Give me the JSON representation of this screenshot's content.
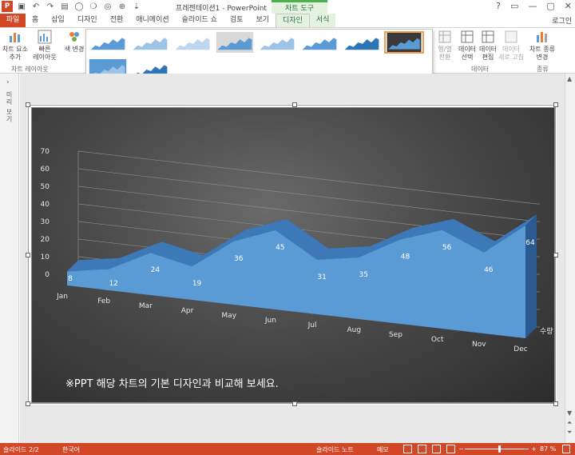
{
  "window": {
    "title": "프레젠테이션1 - PowerPoint",
    "context_tab_group": "차트 도구",
    "login": "로그인",
    "controls": [
      "?",
      "▭",
      "—",
      "▢",
      "✕"
    ]
  },
  "tabs": [
    "파일",
    "홈",
    "삽입",
    "디자인",
    "전환",
    "애니메이션",
    "슬라이드 쇼",
    "검토",
    "보기",
    "디자인",
    "서식"
  ],
  "ribbon": {
    "add_element": "차트 요소\n추가",
    "quick_layout": "빠른\n레이아웃",
    "change_color": "색 변경",
    "layout_group": "차트 레이아웃",
    "switch_row_col": "행/열\n전환",
    "select_data": "데이터\n선택",
    "edit_data": "데이터\n편집",
    "refresh_data": "데이터\n새로 고침",
    "data_group": "데이터",
    "change_type": "차트 종류\n변경",
    "type_group": "종류"
  },
  "gallery": {
    "selected_index": 7,
    "count": 10
  },
  "leftrail": {
    "label": "미리 보기"
  },
  "chart_data": {
    "type": "area",
    "categories": [
      "Jan",
      "Feb",
      "Mar",
      "Apr",
      "May",
      "Jun",
      "Jul",
      "Aug",
      "Sep",
      "Oct",
      "Nov",
      "Dec"
    ],
    "series": [
      {
        "name": "수량",
        "values": [
          8,
          12,
          24,
          19,
          36,
          45,
          31,
          35,
          48,
          56,
          46,
          64
        ]
      }
    ],
    "data_labels": [
      "8",
      "12",
      "24",
      "19",
      "36",
      "45",
      "31",
      "35",
      "48",
      "56",
      "46",
      "64"
    ],
    "yticks": [
      "0",
      "10",
      "20",
      "30",
      "40",
      "50",
      "60",
      "70"
    ],
    "ylim": [
      0,
      70
    ],
    "grid": true,
    "fill_color": "#5b9bd5",
    "background": "#3c3c3c"
  },
  "caption": "※PPT 해당 차트의 기본 디자인과 비교해 보세요.",
  "status": {
    "slide": "슬라이드 2/2",
    "language": "한국어",
    "notes": "슬라이드 노트",
    "comments": "메모",
    "zoom": "87 %"
  }
}
